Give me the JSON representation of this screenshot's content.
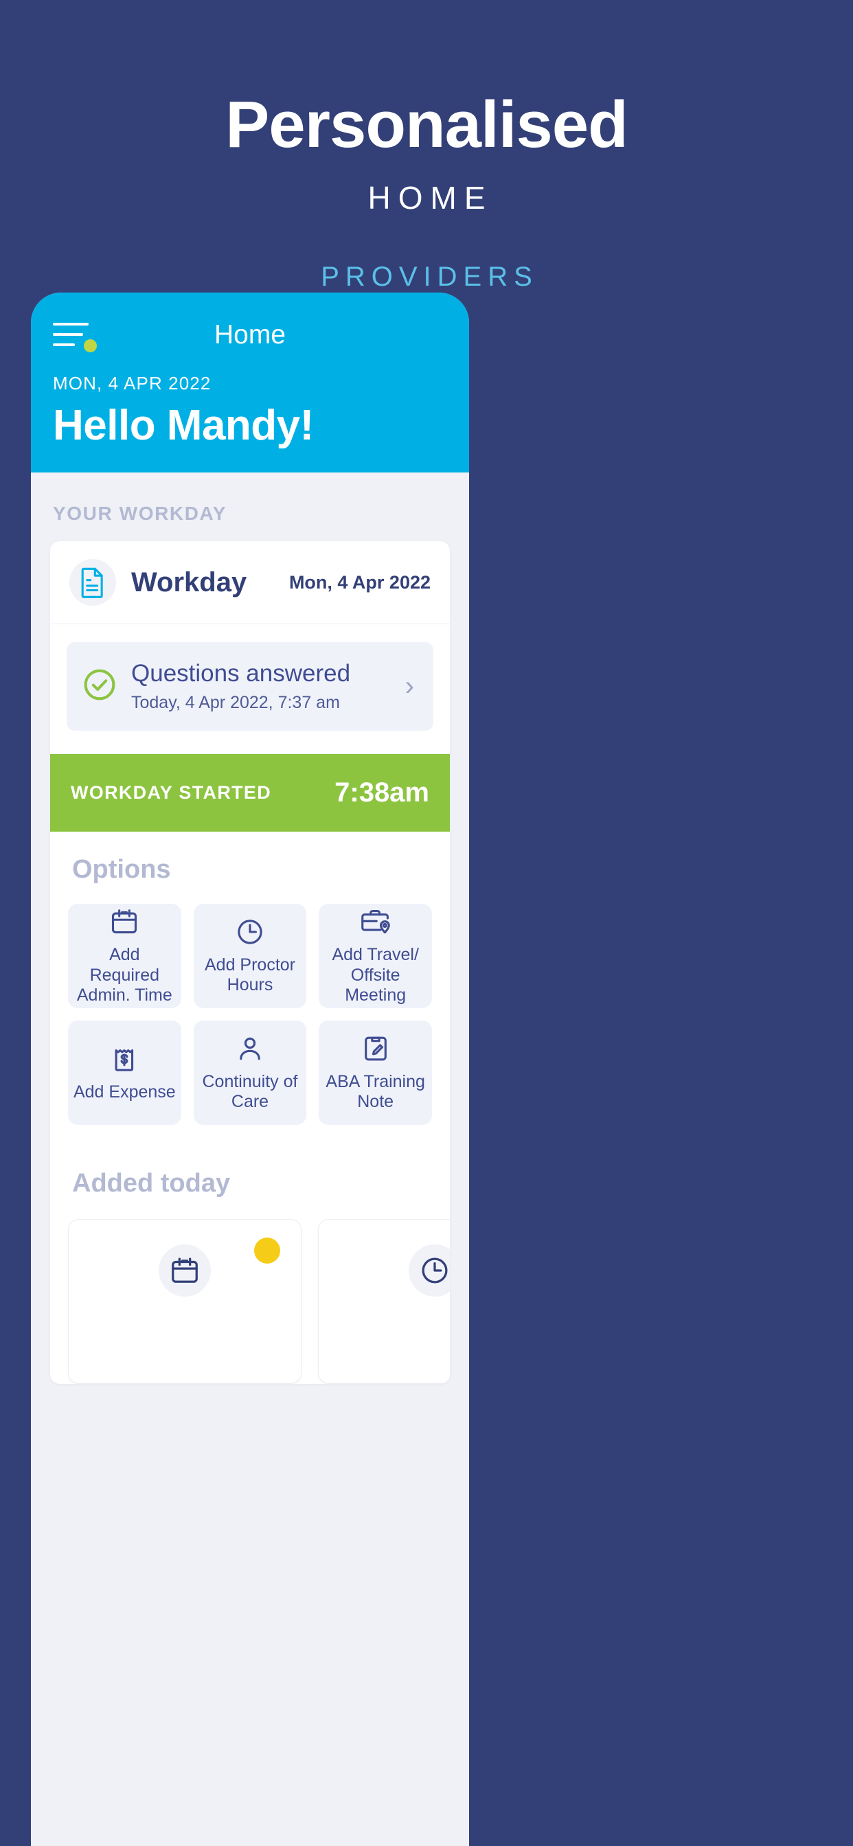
{
  "promo": {
    "title": "Personalised",
    "subtitle": "HOME",
    "tag": "PROVIDERS"
  },
  "colors": {
    "page_background": "#334077",
    "app_header": "#00b0e4",
    "accent_green": "#8cc440",
    "accent_yellow": "#f5cc18",
    "menu_dot": "#c2d644",
    "tag_blue": "#5bc0e8",
    "text_navy": "#334077",
    "muted": "#b3b9d2"
  },
  "app": {
    "nav": {
      "title": "Home",
      "menu_icon": "hamburger-menu-icon",
      "menu_badge_dot": true
    },
    "header": {
      "date": "MON, 4 APR 2022",
      "greeting": "Hello Mandy!"
    },
    "workday_section": {
      "label": "YOUR WORKDAY",
      "card": {
        "icon": "document-icon",
        "title": "Workday",
        "date": "Mon, 4 Apr 2022",
        "status": {
          "icon": "check-circle-icon",
          "title": "Questions answered",
          "subtitle": "Today, 4 Apr 2022, 7:37 am",
          "chevron": "›"
        },
        "banner": {
          "label": "WORKDAY STARTED",
          "time": "7:38am"
        }
      }
    },
    "options": {
      "title": "Options",
      "items": [
        {
          "icon": "calendar-icon",
          "label": "Add Required\nAdmin.  Time"
        },
        {
          "icon": "clock-icon",
          "label": "Add Proctor\nHours"
        },
        {
          "icon": "travel-pin-icon",
          "label": "Add Travel/\nOffsite Meeting"
        },
        {
          "icon": "receipt-dollar-icon",
          "label": "Add Expense"
        },
        {
          "icon": "person-icon",
          "label": "Continuity of\nCare"
        },
        {
          "icon": "note-edit-icon",
          "label": "ABA Training\nNote"
        }
      ]
    },
    "added_today": {
      "title": "Added today",
      "items": [
        {
          "icon": "calendar-icon",
          "badge": true
        },
        {
          "icon": "clock-icon",
          "badge": false
        }
      ]
    }
  }
}
